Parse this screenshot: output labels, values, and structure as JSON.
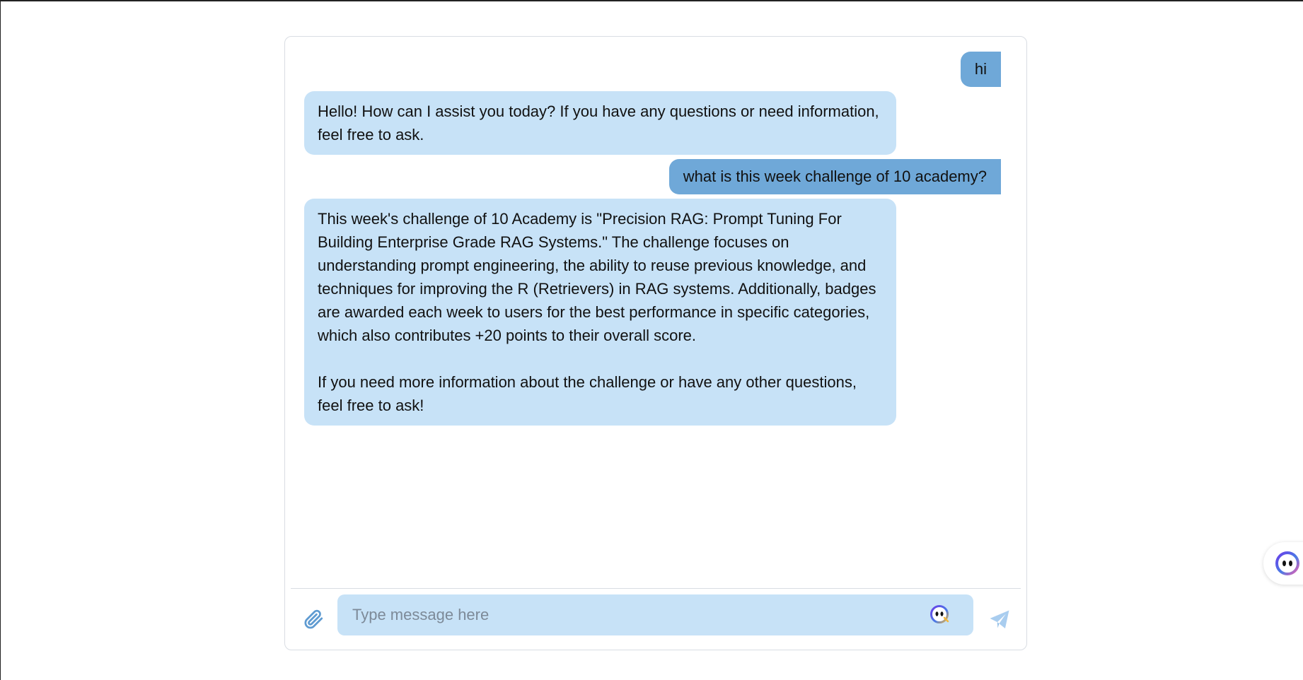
{
  "messages": [
    {
      "role": "user",
      "text": "hi"
    },
    {
      "role": "assistant",
      "text": "Hello! How can I assist you today? If you have any questions or need information, feel free to ask."
    },
    {
      "role": "user",
      "text": "what is this week challenge of 10 academy?"
    },
    {
      "role": "assistant",
      "text": "This week's challenge of 10 Academy is \"Precision RAG: Prompt Tuning For Building Enterprise Grade RAG Systems.\" The challenge focuses on understanding prompt engineering, the ability to reuse previous knowledge, and techniques for improving the R (Retrievers) in RAG systems. Additionally, badges are awarded each week to users for the best performance in specific categories, which also contributes +20 points to their overall score.\n\nIf you need more information about the challenge or have any other questions, feel free to ask!"
    }
  ],
  "composer": {
    "placeholder": "Type message here",
    "value": "",
    "attach_icon": "paperclip-icon",
    "assist_icon": "assistant-bot-icon",
    "send_icon": "send-icon"
  },
  "floating_widget": {
    "icon": "chat-bot-icon"
  },
  "colors": {
    "user_bubble": "#6fa8d8",
    "assistant_bubble": "#c7e2f7",
    "input_bg": "#c7e2f7",
    "icon_blue": "#5f9bd1",
    "send_disabled": "#a9cdef"
  }
}
